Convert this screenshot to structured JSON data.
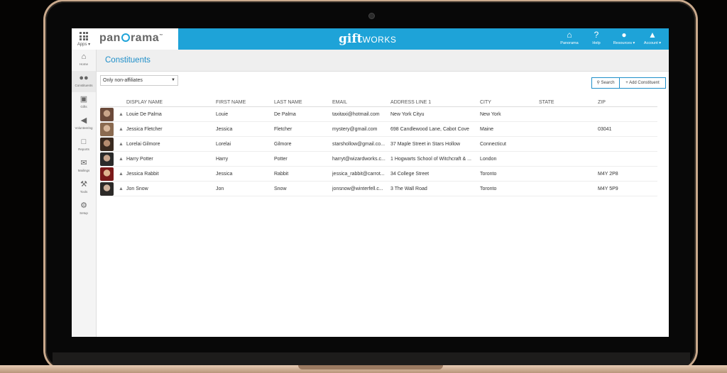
{
  "apps_label": "Apps ▾",
  "brand": {
    "logo_left": "pan",
    "logo_right": "rama",
    "logo_mark": "™",
    "app_logo_bold": "gift",
    "app_logo_text": "WORKS"
  },
  "topnav": [
    {
      "label": "Panorama",
      "icon": "home-icon",
      "glyph": "⌂"
    },
    {
      "label": "Help",
      "icon": "help-icon",
      "glyph": "?"
    },
    {
      "label": "Resources ▾",
      "icon": "chat-icon",
      "glyph": "●"
    },
    {
      "label": "Account ▾",
      "icon": "user-icon",
      "glyph": "▲"
    }
  ],
  "sidebar": [
    {
      "label": "Home",
      "icon": "home-icon",
      "glyph": "⌂"
    },
    {
      "label": "Constituents",
      "icon": "people-icon",
      "glyph": "●●"
    },
    {
      "label": "Gifts",
      "icon": "gift-icon",
      "glyph": "▣"
    },
    {
      "label": "Volunteering",
      "icon": "megaphone-icon",
      "glyph": "◀"
    },
    {
      "label": "Reports",
      "icon": "folder-icon",
      "glyph": "□"
    },
    {
      "label": "Mailings",
      "icon": "envelope-icon",
      "glyph": "✉"
    },
    {
      "label": "Tools",
      "icon": "wrench-icon",
      "glyph": "⚒"
    },
    {
      "label": "Setup",
      "icon": "gears-icon",
      "glyph": "⚙"
    }
  ],
  "page": {
    "title": "Constituents"
  },
  "filter": {
    "value": "Only non-affiliates"
  },
  "buttons": {
    "search": "Search",
    "add": "Add Constituent"
  },
  "table": {
    "columns": [
      "DISPLAY NAME",
      "FIRST NAME",
      "LAST NAME",
      "EMAIL",
      "ADDRESS LINE 1",
      "CITY",
      "STATE",
      "ZIP"
    ],
    "rows": [
      {
        "display": "Louie De Palma",
        "first": "Louie",
        "last": "De Palma",
        "email": "taxitaxi@hotmail.com",
        "address": "New York Cityu",
        "city": "New York",
        "state": "",
        "zip": ""
      },
      {
        "display": "Jessica Fletcher",
        "first": "Jessica",
        "last": "Fletcher",
        "email": "mystery@gmail.com",
        "address": "698 Candlewood Lane, Cabot Cove",
        "city": "Maine",
        "state": "",
        "zip": "03041"
      },
      {
        "display": "Lorelai Gilmore",
        "first": "Lorelai",
        "last": "Gilmore",
        "email": "starshollow@gmail.co...",
        "address": "37 Maple Street in Stars Hollow",
        "city": "Connecticut",
        "state": "",
        "zip": ""
      },
      {
        "display": "Harry Potter",
        "first": "Harry",
        "last": "Potter",
        "email": "harryt@wizardworks.c...",
        "address": "1 Hogwarts School of Witchcraft & ...",
        "city": "London",
        "state": "",
        "zip": ""
      },
      {
        "display": "Jessica Rabbit",
        "first": "Jessica",
        "last": "Rabbit",
        "email": "jessica_rabbit@carrot...",
        "address": "34 College Street",
        "city": "Toronto",
        "state": "",
        "zip": "M4Y 2P8"
      },
      {
        "display": "Jon Snow",
        "first": "Jon",
        "last": "Snow",
        "email": "jonsnow@winterfell.c...",
        "address": "3 The Wall Road",
        "city": "Toronto",
        "state": "",
        "zip": "M4Y 5P9"
      }
    ]
  },
  "colors": {
    "accent": "#1ea3d8",
    "title": "#1f8fc9"
  }
}
